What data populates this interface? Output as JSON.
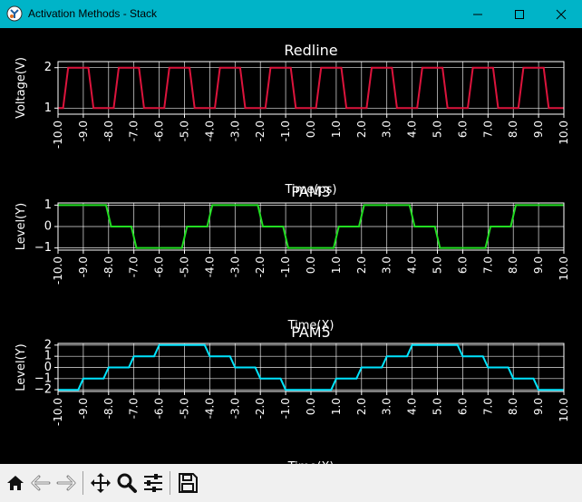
{
  "window": {
    "title": "Activation Methods - Stack",
    "minimize_icon": "minimize-icon",
    "maximize_icon": "maximize-icon",
    "close_icon": "close-icon"
  },
  "toolbar": {
    "buttons": [
      {
        "name": "home-button",
        "icon": "home-icon"
      },
      {
        "name": "back-button",
        "icon": "back-arrow-icon"
      },
      {
        "name": "forward-button",
        "icon": "forward-arrow-icon"
      },
      {
        "name": "pan-button",
        "icon": "move-icon"
      },
      {
        "name": "zoom-button",
        "icon": "magnifier-icon"
      },
      {
        "name": "configure-subplots-button",
        "icon": "sliders-icon"
      },
      {
        "name": "save-button",
        "icon": "floppy-disk-icon"
      }
    ]
  },
  "colors": {
    "redline": "#dc143c",
    "pam3": "#22dd22",
    "pam5": "#00e5ff",
    "background": "#000000",
    "grid": "#ffffff",
    "titlebar": "#00b4c8"
  },
  "chart_data": [
    {
      "type": "line",
      "title": "Redline",
      "xlabel": "Time(ps)",
      "ylabel": "Voltage(V)",
      "xlim": [
        -10,
        10
      ],
      "ylim": [
        0.85,
        2.15
      ],
      "grid": true,
      "xticks": [
        "-10.0",
        "-9.0",
        "-8.0",
        "-7.0",
        "-6.0",
        "-5.0",
        "-4.0",
        "-3.0",
        "-2.0",
        "-1.0",
        "0.0",
        "1.0",
        "2.0",
        "3.0",
        "4.0",
        "5.0",
        "6.0",
        "7.0",
        "8.0",
        "9.0",
        "10.0"
      ],
      "yticks": [
        "1",
        "2"
      ],
      "ytick_values": [
        1,
        2
      ],
      "series": [
        {
          "x": [
            -10,
            -9.8,
            -9.6,
            -9.0,
            -8.8,
            -8.6,
            -8.0,
            -7.8,
            -7.6,
            -7.0,
            -6.8,
            -6.6,
            -6.0,
            -5.8,
            -5.6,
            -5.0,
            -4.8,
            -4.6,
            -4.0,
            -3.8,
            -3.6,
            -3.0,
            -2.8,
            -2.6,
            -2.0,
            -1.8,
            -1.6,
            -1.0,
            -0.8,
            -0.6,
            0.0,
            0.2,
            0.4,
            1.0,
            1.2,
            1.4,
            2.0,
            2.2,
            2.4,
            3.0,
            3.2,
            3.4,
            4.0,
            4.2,
            4.4,
            5.0,
            5.2,
            5.4,
            6.0,
            6.2,
            6.4,
            7.0,
            7.2,
            7.4,
            8.0,
            8.2,
            8.4,
            9.0,
            9.2,
            9.4,
            10.0
          ],
          "y": [
            1,
            1,
            2,
            2,
            2,
            1,
            1,
            1,
            2,
            2,
            2,
            1,
            1,
            1,
            2,
            2,
            2,
            1,
            1,
            1,
            2,
            2,
            2,
            1,
            1,
            1,
            2,
            2,
            2,
            1,
            1,
            1,
            2,
            2,
            2,
            1,
            1,
            1,
            2,
            2,
            2,
            1,
            1,
            1,
            2,
            2,
            2,
            1,
            1,
            1,
            2,
            2,
            2,
            1,
            1,
            1,
            2,
            2,
            2,
            1,
            1
          ]
        }
      ]
    },
    {
      "type": "line",
      "title": "PAM3",
      "xlabel": "Time(X)",
      "ylabel": "Level(Y)",
      "xlim": [
        -10,
        10
      ],
      "ylim": [
        -1.1,
        1.1
      ],
      "grid": true,
      "xticks": [
        "-10.0",
        "-9.0",
        "-8.0",
        "-7.0",
        "-6.0",
        "-5.0",
        "-4.0",
        "-3.0",
        "-2.0",
        "-1.0",
        "0.0",
        "1.0",
        "2.0",
        "3.0",
        "4.0",
        "5.0",
        "6.0",
        "7.0",
        "8.0",
        "9.0",
        "10.0"
      ],
      "yticks": [
        "−1",
        "0",
        "1"
      ],
      "ytick_values": [
        -1,
        0,
        1
      ],
      "series": [
        {
          "x": [
            -10,
            -8.1,
            -7.9,
            -7.1,
            -6.9,
            -5.1,
            -4.9,
            -4.1,
            -3.9,
            -2.1,
            -1.9,
            -1.1,
            -0.9,
            0.9,
            1.1,
            1.9,
            2.1,
            3.9,
            4.1,
            4.9,
            5.1,
            6.9,
            7.1,
            7.9,
            8.1,
            10
          ],
          "y": [
            1,
            1,
            0,
            0,
            -1,
            -1,
            0,
            0,
            1,
            1,
            0,
            0,
            -1,
            -1,
            0,
            0,
            1,
            1,
            0,
            0,
            -1,
            -1,
            0,
            0,
            1,
            1
          ]
        }
      ]
    },
    {
      "type": "line",
      "title": "PAM5",
      "xlabel": "Time(X)",
      "ylabel": "Level(Y)",
      "xlim": [
        -10,
        10
      ],
      "ylim": [
        -2.15,
        2.15
      ],
      "grid": true,
      "xticks": [
        "-10.0",
        "-9.0",
        "-8.0",
        "-7.0",
        "-6.0",
        "-5.0",
        "-4.0",
        "-3.0",
        "-2.0",
        "-1.0",
        "0.0",
        "1.0",
        "2.0",
        "3.0",
        "4.0",
        "5.0",
        "6.0",
        "7.0",
        "8.0",
        "9.0",
        "10.0"
      ],
      "yticks": [
        "−2",
        "−1",
        "0",
        "1",
        "2"
      ],
      "ytick_values": [
        -2,
        -1,
        0,
        1,
        2
      ],
      "series": [
        {
          "x": [
            -10,
            -9.2,
            -9.0,
            -8.2,
            -8.0,
            -7.2,
            -7.0,
            -6.2,
            -6.0,
            -4.2,
            -4.0,
            -3.2,
            -3.0,
            -2.2,
            -2.0,
            -1.2,
            -1.0,
            0.8,
            1.0,
            1.8,
            2.0,
            2.8,
            3.0,
            3.8,
            4.0,
            5.8,
            6.0,
            6.8,
            7.0,
            7.8,
            8.0,
            8.8,
            9.0,
            10
          ],
          "y": [
            -2,
            -2,
            -1,
            -1,
            0,
            0,
            1,
            1,
            2,
            2,
            1,
            1,
            0,
            0,
            -1,
            -1,
            -2,
            -2,
            -1,
            -1,
            0,
            0,
            1,
            1,
            2,
            2,
            1,
            1,
            0,
            0,
            -1,
            -1,
            -2,
            -2
          ]
        }
      ]
    }
  ]
}
